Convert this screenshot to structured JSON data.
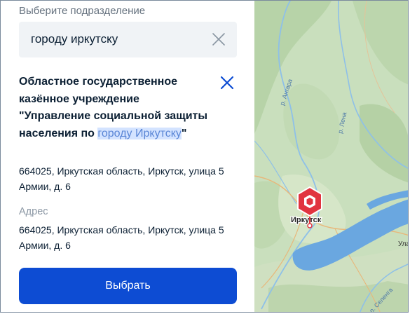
{
  "selector": {
    "label": "Выберите подразделение",
    "search_value": "городу иркутску"
  },
  "organization": {
    "name_prefix": "Областное государственное казённое учреждение \"Управление социальной защиты населения по ",
    "name_highlight": "городу Иркутску",
    "name_suffix": "\"",
    "address": "664025, Иркутская область, Иркутск, улица 5 Армии, д. 6",
    "address_label": "Адрес",
    "address_repeat": "664025, Иркутская область, Иркутск, улица 5 Армии, д. 6"
  },
  "actions": {
    "select_label": "Выбрать"
  },
  "map": {
    "city_label": "Иркутск",
    "river_angara": "р. Ангара",
    "river_lena": "р. Лена",
    "river_selenga": "р. Селенга",
    "partial_label": "Ула",
    "marker_color": "#e1343f",
    "lake_color": "#6aa7e0"
  },
  "colors": {
    "accent": "#0d4cd3",
    "highlight_bg": "#d3e3ff",
    "text": "#0b1f33",
    "muted": "#66727f"
  }
}
